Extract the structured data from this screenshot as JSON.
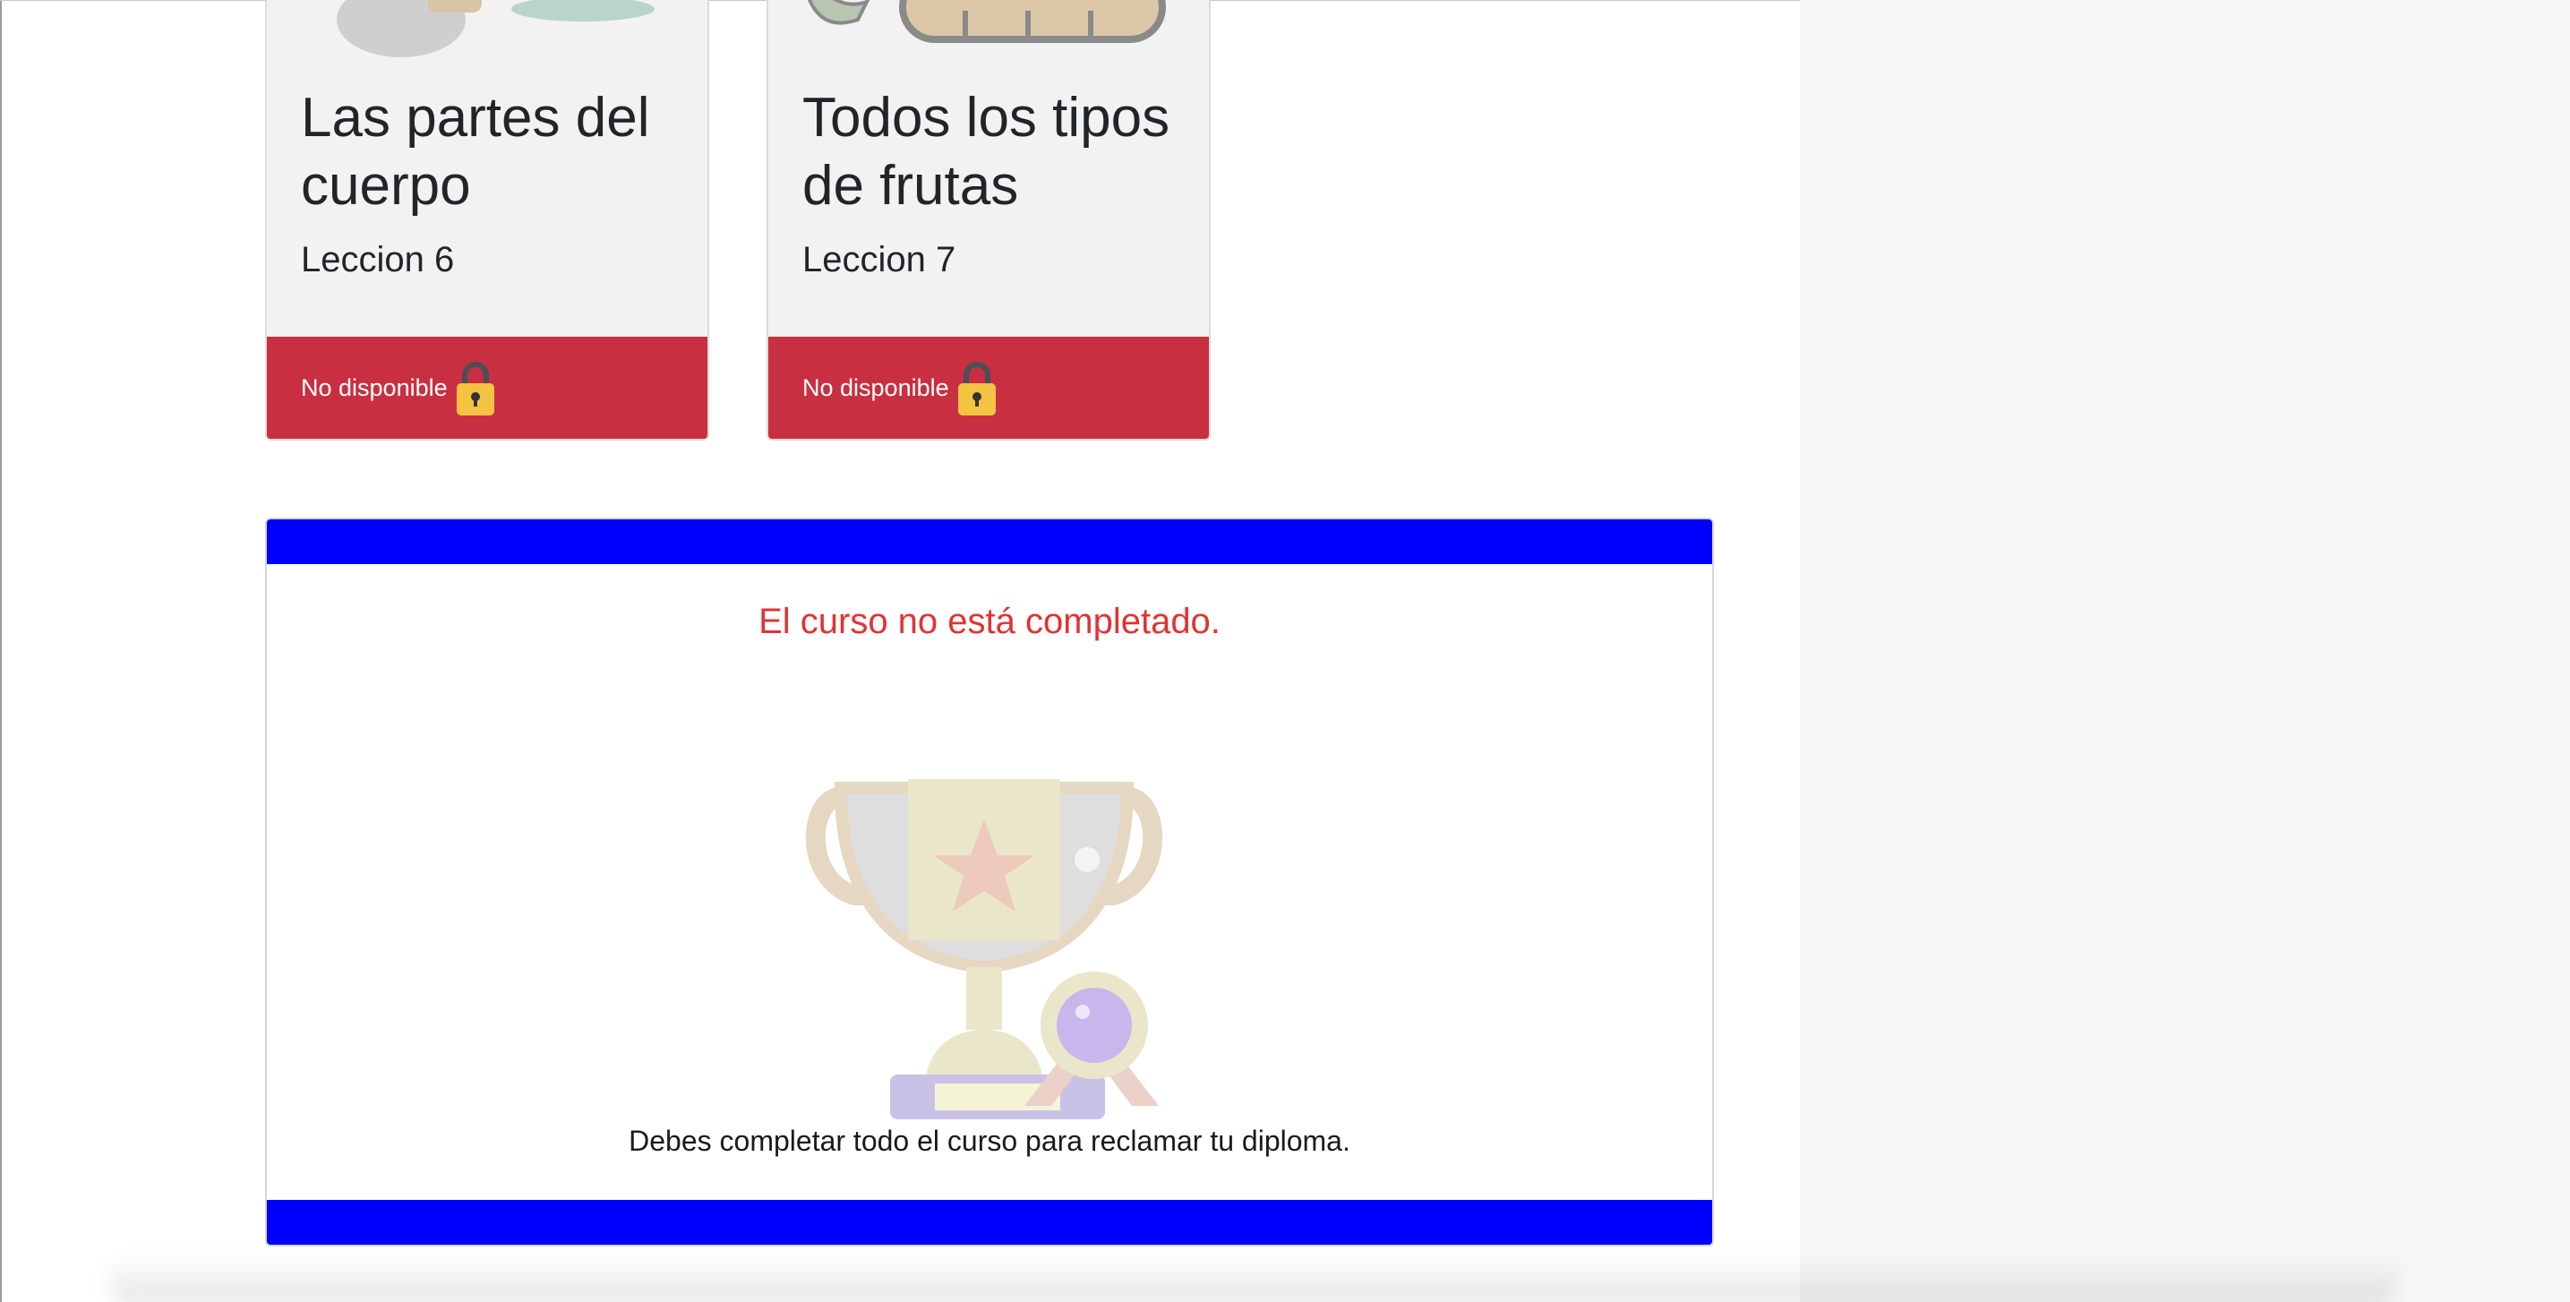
{
  "lessons": [
    {
      "title": "Las partes del cuerpo",
      "subtitle": "Leccion 6",
      "status": "No disponible",
      "icon": "lock-icon"
    },
    {
      "title": "Todos los tipos de frutas",
      "subtitle": "Leccion 7",
      "status": "No disponible",
      "icon": "lock-icon"
    }
  ],
  "diploma": {
    "status_message": "El curso no está completado.",
    "instruction": "Debes completar todo el curso para reclamar tu diploma.",
    "icon": "trophy-icon"
  },
  "colors": {
    "unavailable_red": "#c82f41",
    "banner_blue": "#0000ff",
    "status_red": "#df3434",
    "lock_yellow": "#f5c342"
  }
}
